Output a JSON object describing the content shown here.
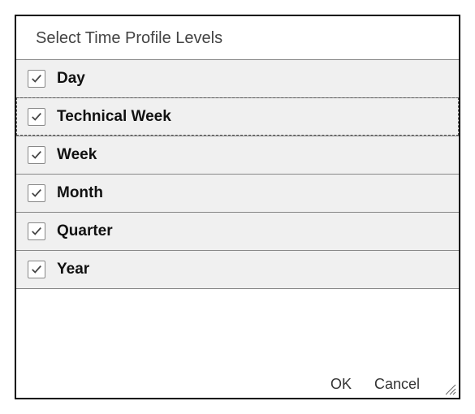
{
  "dialog": {
    "title": "Select Time Profile Levels",
    "items": [
      {
        "label": "Day",
        "checked": true,
        "focused": false
      },
      {
        "label": "Technical Week",
        "checked": true,
        "focused": true
      },
      {
        "label": "Week",
        "checked": true,
        "focused": false
      },
      {
        "label": "Month",
        "checked": true,
        "focused": false
      },
      {
        "label": "Quarter",
        "checked": true,
        "focused": false
      },
      {
        "label": "Year",
        "checked": true,
        "focused": false
      }
    ],
    "buttons": {
      "ok": "OK",
      "cancel": "Cancel"
    }
  }
}
